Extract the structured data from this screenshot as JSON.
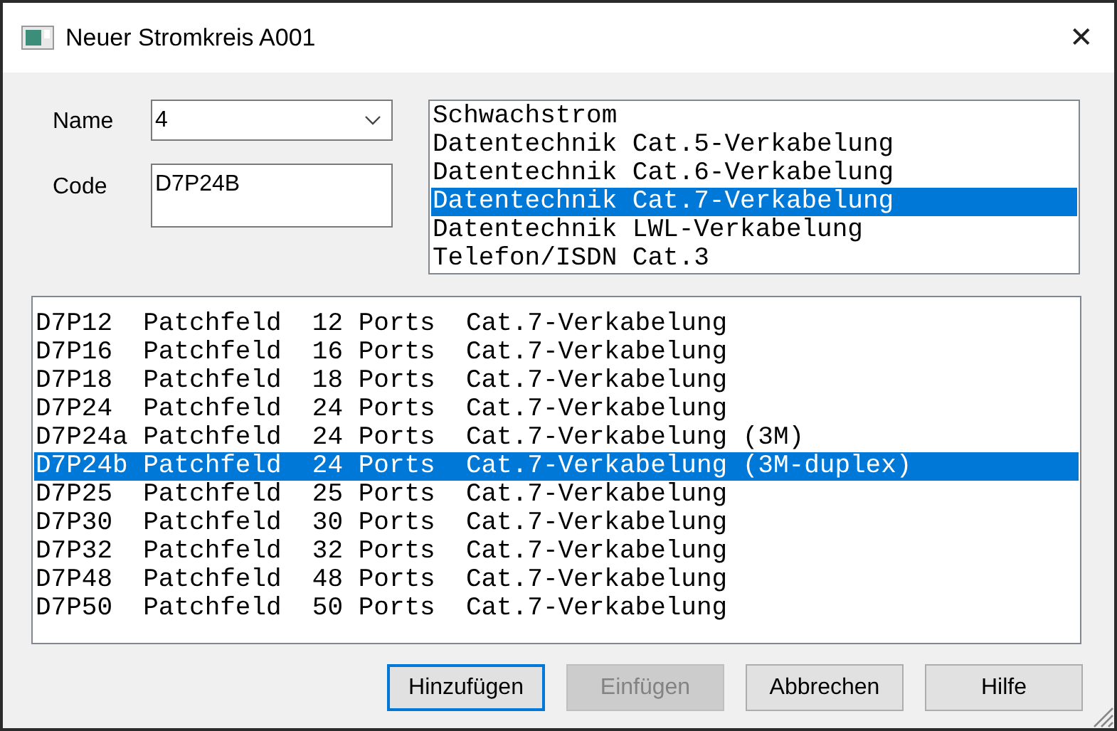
{
  "window": {
    "title": "Neuer Stromkreis  A001",
    "close": "✕"
  },
  "name_field": {
    "label": "Name",
    "value": "4"
  },
  "code_field": {
    "label": "Code",
    "value": "D7P24B"
  },
  "categories": [
    {
      "label": "Schwachstrom",
      "selected": false
    },
    {
      "label": "Datentechnik Cat.5-Verkabelung",
      "selected": false
    },
    {
      "label": "Datentechnik Cat.6-Verkabelung",
      "selected": false
    },
    {
      "label": "Datentechnik Cat.7-Verkabelung",
      "selected": true
    },
    {
      "label": "Datentechnik LWL-Verkabelung",
      "selected": false
    },
    {
      "label": "Telefon/ISDN Cat.3",
      "selected": false
    }
  ],
  "items": [
    {
      "label": "D7P12  Patchfeld  12 Ports  Cat.7-Verkabelung",
      "selected": false
    },
    {
      "label": "D7P16  Patchfeld  16 Ports  Cat.7-Verkabelung",
      "selected": false
    },
    {
      "label": "D7P18  Patchfeld  18 Ports  Cat.7-Verkabelung",
      "selected": false
    },
    {
      "label": "D7P24  Patchfeld  24 Ports  Cat.7-Verkabelung",
      "selected": false
    },
    {
      "label": "D7P24a Patchfeld  24 Ports  Cat.7-Verkabelung (3M)",
      "selected": false
    },
    {
      "label": "D7P24b Patchfeld  24 Ports  Cat.7-Verkabelung (3M-duplex)",
      "selected": true
    },
    {
      "label": "D7P25  Patchfeld  25 Ports  Cat.7-Verkabelung",
      "selected": false
    },
    {
      "label": "D7P30  Patchfeld  30 Ports  Cat.7-Verkabelung",
      "selected": false
    },
    {
      "label": "D7P32  Patchfeld  32 Ports  Cat.7-Verkabelung",
      "selected": false
    },
    {
      "label": "D7P48  Patchfeld  48 Ports  Cat.7-Verkabelung",
      "selected": false
    },
    {
      "label": "D7P50  Patchfeld  50 Ports  Cat.7-Verkabelung",
      "selected": false
    }
  ],
  "buttons": [
    {
      "label": "Hinzufügen",
      "disabled": false,
      "default": true
    },
    {
      "label": "Einfügen",
      "disabled": true,
      "default": false
    },
    {
      "label": "Abbrechen",
      "disabled": false,
      "default": false
    },
    {
      "label": "Hilfe",
      "disabled": false,
      "default": false
    }
  ]
}
